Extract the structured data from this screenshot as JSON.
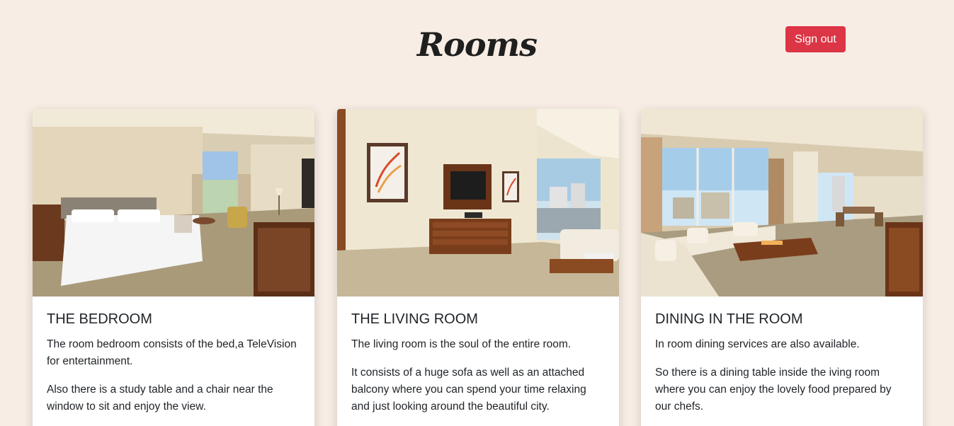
{
  "header": {
    "title": "Rooms",
    "signout_label": "Sign out",
    "signout_color": "#dc3545",
    "background": "#f7ede4"
  },
  "cards": [
    {
      "title": "THE BEDROOM",
      "image": "hotel-bedroom-photo",
      "paragraphs": [
        "The room bedroom consists of the bed,a TeleVision for entertainment.",
        "Also there is a study table and a chair near the window to sit and enjoy the view."
      ]
    },
    {
      "title": "THE LIVING ROOM",
      "image": "hotel-living-room-photo",
      "paragraphs": [
        "The living room is the soul of the entire room.",
        "It consists of a huge sofa as well as an attached balcony where you can spend your time relaxing and just looking around the beautiful city."
      ]
    },
    {
      "title": "DINING IN THE ROOM",
      "image": "hotel-dining-room-photo",
      "paragraphs": [
        "In room dining services are also available.",
        "So there is a dining table inside the iving room where you can enjoy the lovely food prepared by our chefs."
      ]
    }
  ]
}
